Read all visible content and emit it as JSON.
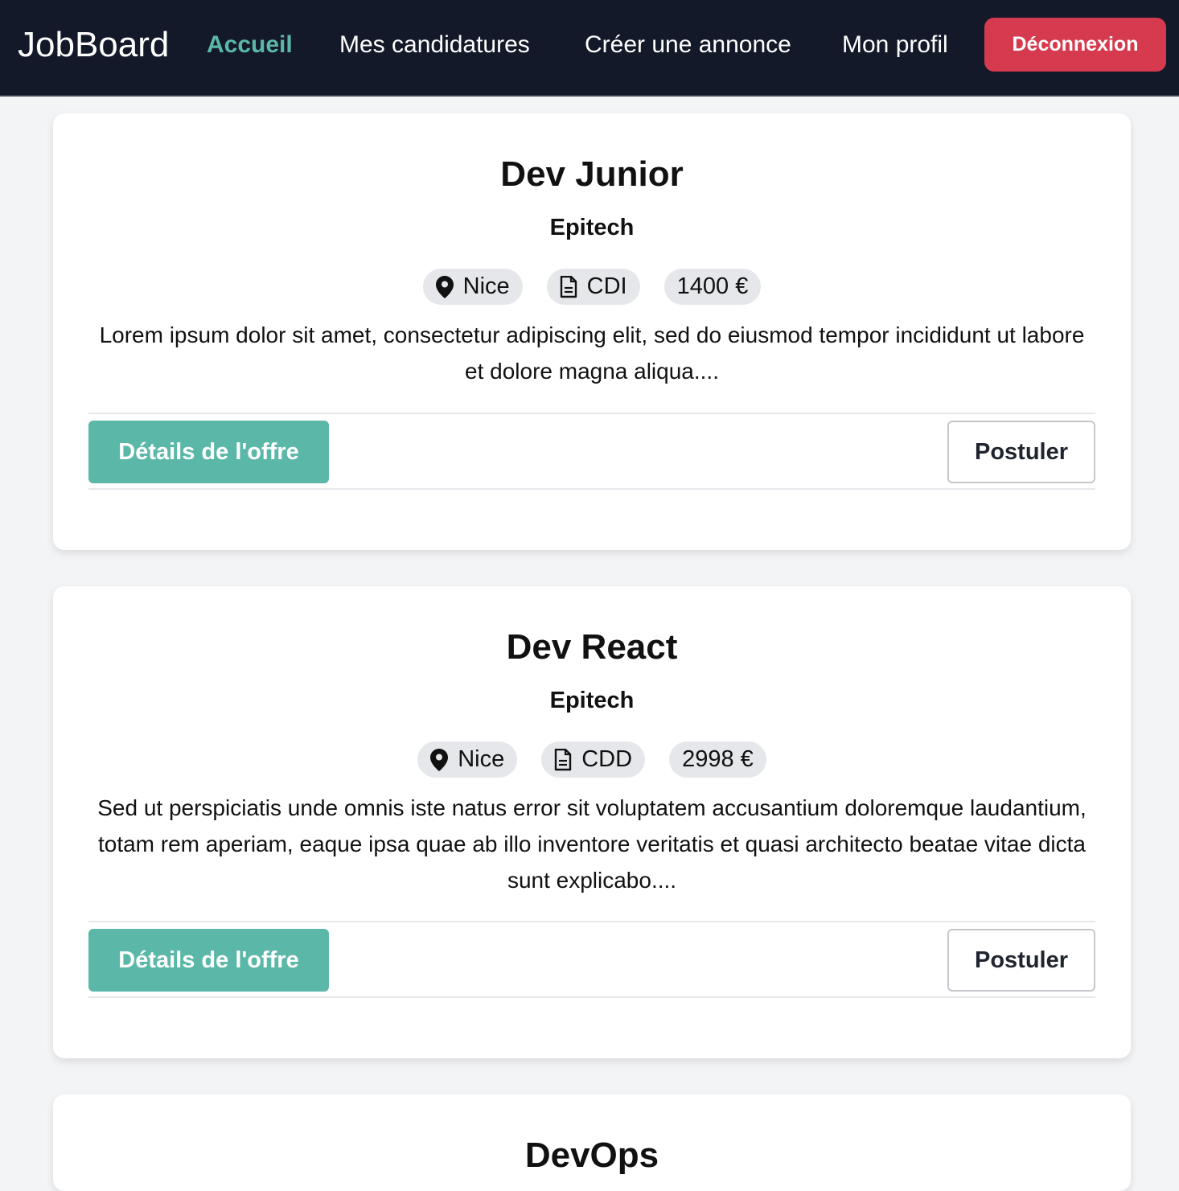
{
  "colors": {
    "navbar_bg": "#131928",
    "accent": "#5bb8a8",
    "logout_bg": "#d63a4e",
    "page_bg": "#f3f4f6"
  },
  "navbar": {
    "brand": "JobBoard",
    "links": [
      {
        "label": "Accueil",
        "active": true
      },
      {
        "label": "Mes candidatures",
        "active": false
      },
      {
        "label": "Créer une annonce",
        "active": false
      },
      {
        "label": "Mon profil",
        "active": false
      }
    ],
    "logout_label": "Déconnexion"
  },
  "jobs": [
    {
      "title": "Dev Junior",
      "company": "Epitech",
      "location": "Nice",
      "contract": "CDI",
      "salary": "1400 €",
      "description": "Lorem ipsum dolor sit amet, consectetur adipiscing elit, sed do eiusmod tempor incididunt ut labore et dolore magna aliqua....",
      "details_label": "Détails de l'offre",
      "apply_label": "Postuler",
      "location_icon": "map-pin-icon",
      "contract_icon": "document-icon"
    },
    {
      "title": "Dev React",
      "company": "Epitech",
      "location": "Nice",
      "contract": "CDD",
      "salary": "2998 €",
      "description": "Sed ut perspiciatis unde omnis iste natus error sit voluptatem accusantium doloremque laudantium, totam rem aperiam, eaque ipsa quae ab illo inventore veritatis et quasi architecto beatae vitae dicta sunt explicabo....",
      "details_label": "Détails de l'offre",
      "apply_label": "Postuler",
      "location_icon": "map-pin-icon",
      "contract_icon": "document-icon"
    },
    {
      "title": "DevOps"
    }
  ]
}
